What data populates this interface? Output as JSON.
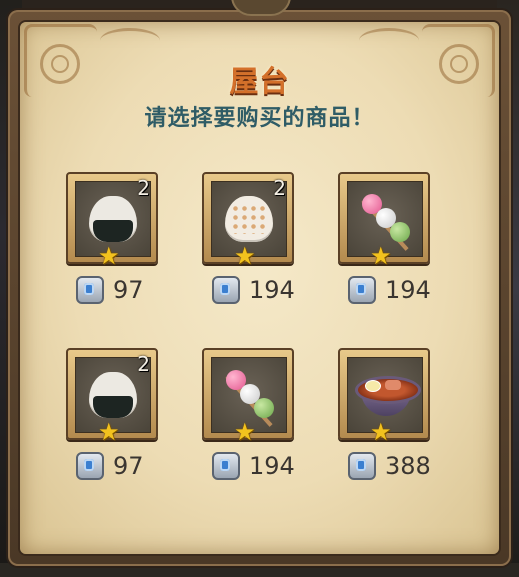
{
  "dialog": {
    "title": "屋台",
    "subtitle": "请选择要购买的商品！"
  },
  "items": [
    {
      "icon": "onigiri-nori-icon",
      "quantity": "2",
      "stars": 1,
      "currency_icon": "silver-gem-icon",
      "price": "97"
    },
    {
      "icon": "onigiri-plain-icon",
      "quantity": "2",
      "stars": 1,
      "currency_icon": "silver-gem-icon",
      "price": "194"
    },
    {
      "icon": "dango-icon",
      "quantity": "",
      "stars": 1,
      "currency_icon": "silver-gem-icon",
      "price": "194"
    },
    {
      "icon": "onigiri-nori-icon",
      "quantity": "2",
      "stars": 1,
      "currency_icon": "silver-gem-icon",
      "price": "97"
    },
    {
      "icon": "dango-icon",
      "quantity": "",
      "stars": 1,
      "currency_icon": "silver-gem-icon",
      "price": "194"
    },
    {
      "icon": "ramen-bowl-icon",
      "quantity": "",
      "stars": 1,
      "currency_icon": "silver-gem-icon",
      "price": "388"
    }
  ],
  "colors": {
    "title": "#d4702a",
    "subtitle": "#2f5c66",
    "star": "#f2c21e",
    "parchment": "#eddcb4"
  }
}
